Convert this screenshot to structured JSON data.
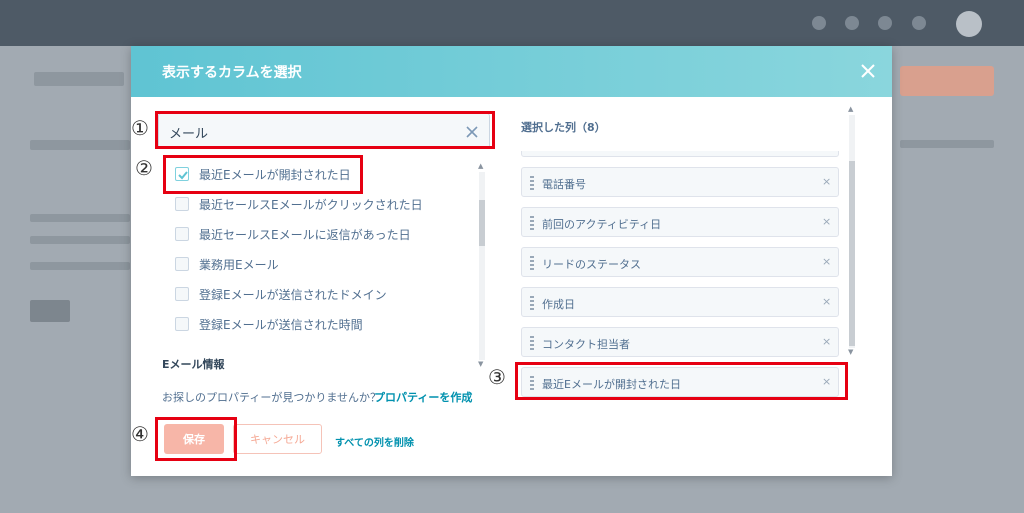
{
  "background": {
    "topbar_color": "#4e5a66"
  },
  "modal": {
    "title": "表示するカラムを選択",
    "close_icon": "close-icon",
    "header_gradient": [
      "#5fc4d3",
      "#8ad6dd"
    ]
  },
  "search": {
    "value": "メール",
    "clear_icon": "clear-icon"
  },
  "options": [
    {
      "label": "最近Eメールが開封された日",
      "checked": true
    },
    {
      "label": "最近セールスEメールがクリックされた日",
      "checked": false
    },
    {
      "label": "最近セールスEメールに返信があった日",
      "checked": false
    },
    {
      "label": "業務用Eメール",
      "checked": false
    },
    {
      "label": "登録Eメールが送信されたドメイン",
      "checked": false
    },
    {
      "label": "登録Eメールが送信された時間",
      "checked": false
    }
  ],
  "group_heading": "Eメール情報",
  "missing": {
    "text": "お探しのプロパティーが見つかりませんか？",
    "link": "プロパティーを作成"
  },
  "buttons": {
    "save": "保存",
    "cancel": "キャンセル",
    "remove_all": "すべての列を削除"
  },
  "selected": {
    "heading": "選択した列（8）",
    "items": [
      {
        "label": "電話番号"
      },
      {
        "label": "前回のアクティビティ日"
      },
      {
        "label": "リードのステータス"
      },
      {
        "label": "作成日"
      },
      {
        "label": "コンタクト担当者"
      },
      {
        "label": "最近Eメールが開封された日"
      }
    ],
    "remove_glyph": "×"
  },
  "annotations": [
    "①",
    "②",
    "③",
    "④"
  ],
  "colors": {
    "accent": "#0091ae",
    "annotation_red": "#e60012",
    "save_button": "#f7b6a8"
  }
}
